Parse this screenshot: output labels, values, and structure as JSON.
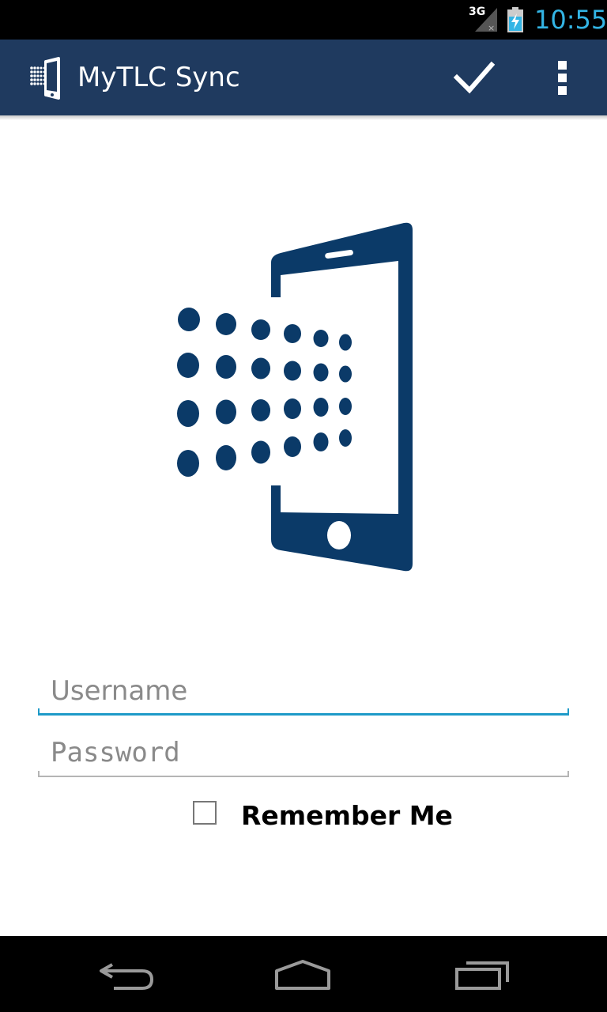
{
  "status_bar": {
    "network": "3G",
    "time": "10:55"
  },
  "action_bar": {
    "title": "MyTLC Sync",
    "icons": {
      "app": "phone-dots-icon",
      "confirm": "checkmark-icon",
      "overflow": "overflow-menu-icon"
    }
  },
  "logo": {
    "icon": "phone-sync-logo",
    "color": "#0b3a68"
  },
  "form": {
    "username": {
      "value": "",
      "placeholder": "Username"
    },
    "password": {
      "value": "",
      "placeholder": "Password"
    },
    "remember_me": {
      "label": "Remember Me",
      "checked": false
    }
  },
  "nav_bar": {
    "icons": [
      "back-icon",
      "home-icon",
      "recents-icon"
    ]
  },
  "colors": {
    "action_bar": "#1f3a5f",
    "accent": "#33b5e5",
    "field_focus": "#1e9ac8"
  }
}
